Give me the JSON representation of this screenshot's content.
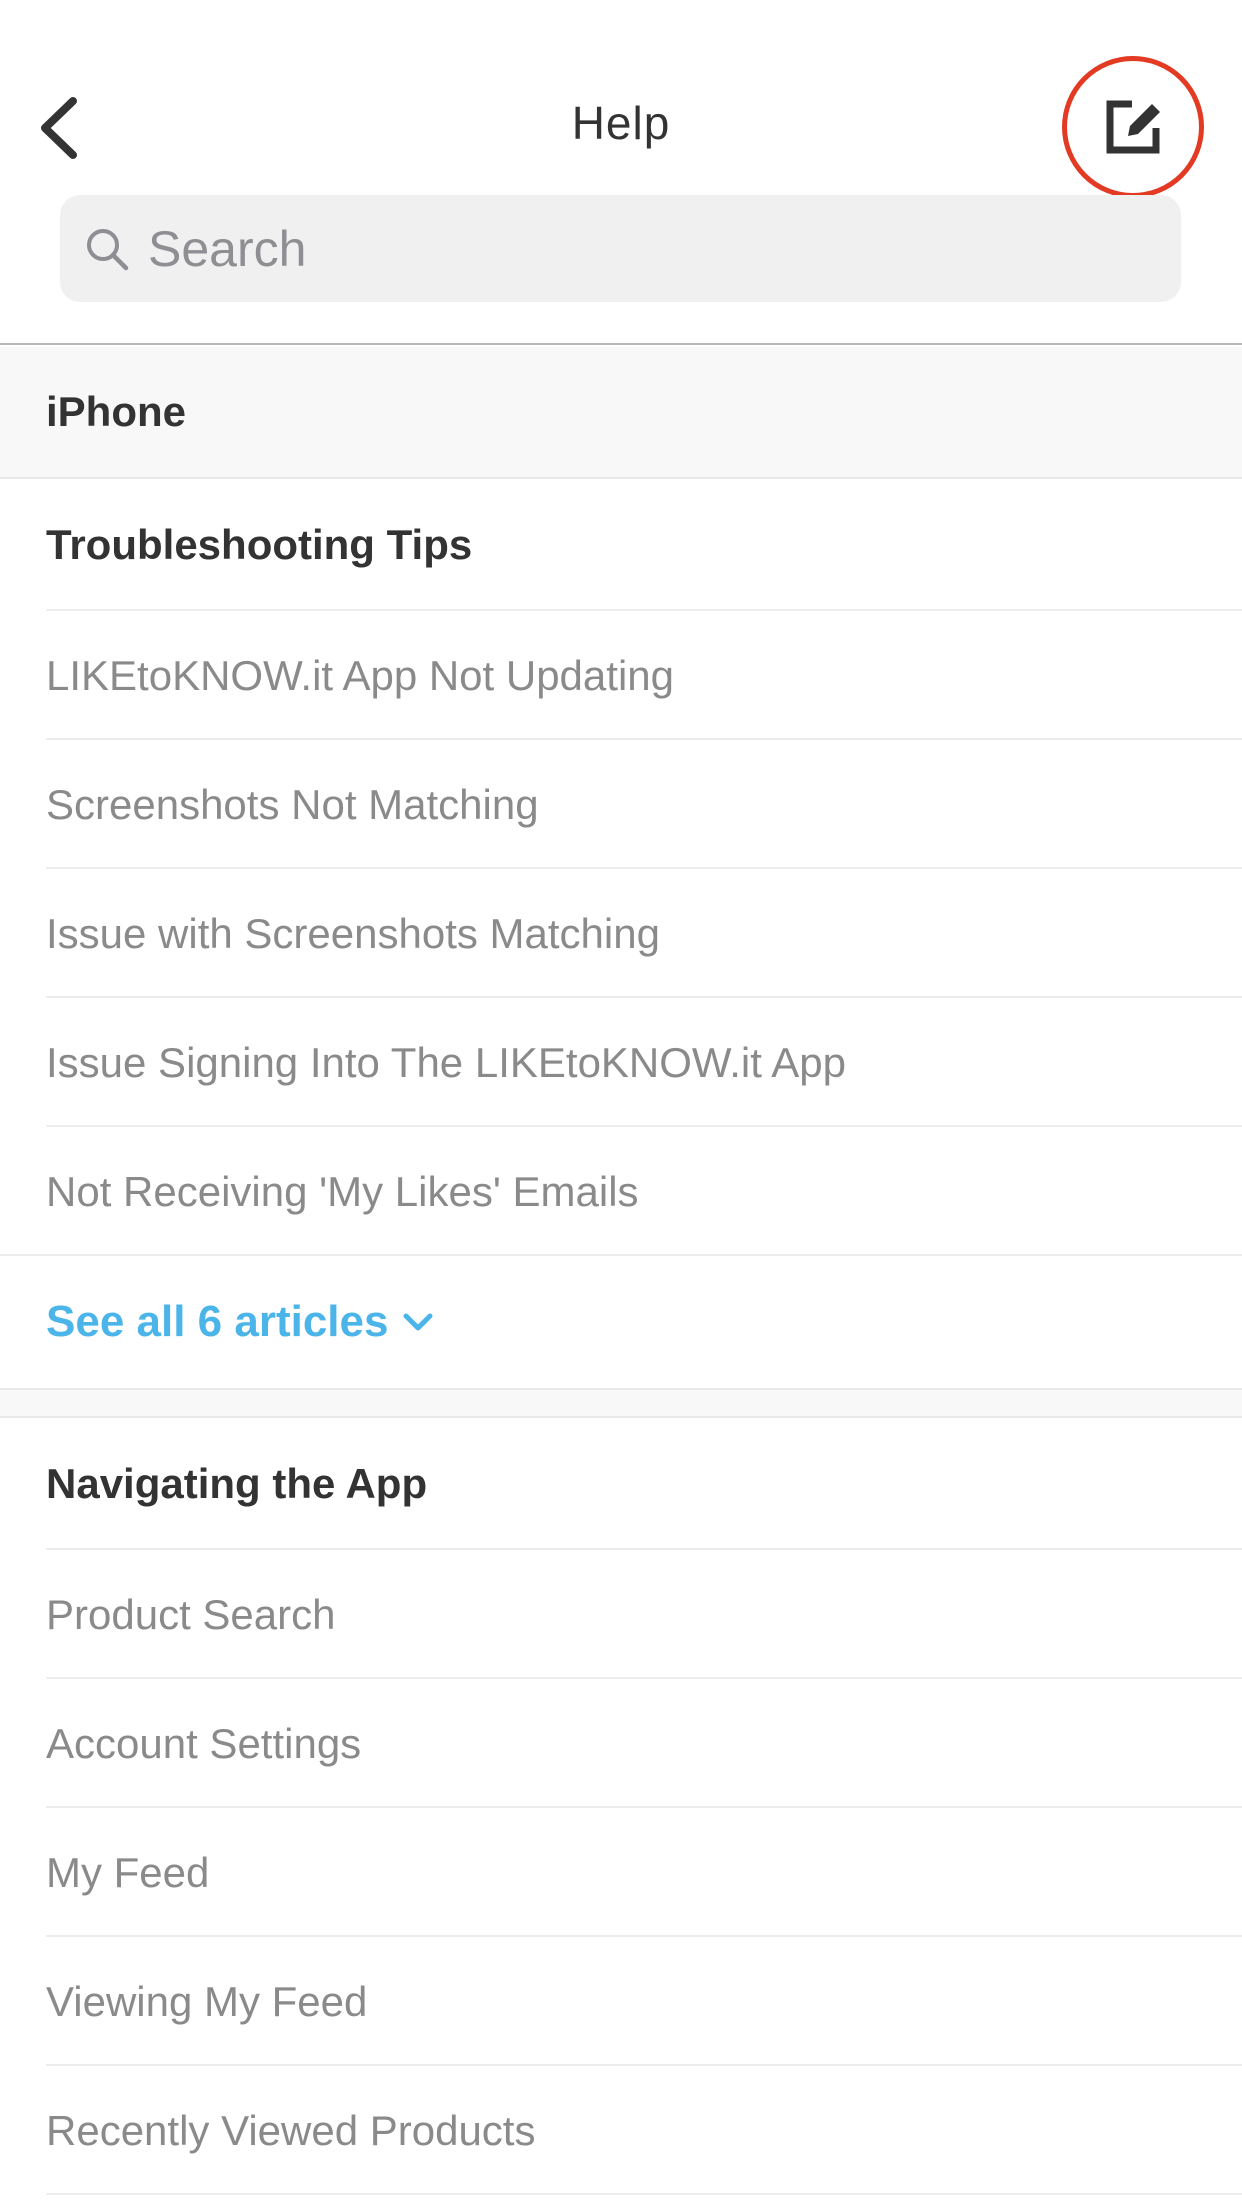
{
  "header": {
    "title": "Help",
    "back_icon": "chevron-left-icon",
    "compose_icon": "compose-icon",
    "highlight_color": "#e23a23"
  },
  "search": {
    "placeholder": "Search",
    "value": ""
  },
  "section": {
    "label": "iPhone"
  },
  "categories": [
    {
      "title": "Troubleshooting Tips",
      "articles": [
        "LIKEtoKNOW.it App Not Updating",
        "Screenshots Not Matching",
        "Issue with Screenshots Matching",
        "Issue Signing Into The LIKEtoKNOW.it App",
        "Not Receiving 'My Likes' Emails"
      ],
      "see_all": "See all 6 articles"
    },
    {
      "title": "Navigating the App",
      "articles": [
        "Product Search",
        "Account Settings",
        "My Feed",
        "Viewing My Feed",
        "Recently Viewed Products"
      ]
    }
  ],
  "colors": {
    "link": "#4bb5ea",
    "article_text": "#8a8a8a",
    "heading_text": "#333333"
  }
}
